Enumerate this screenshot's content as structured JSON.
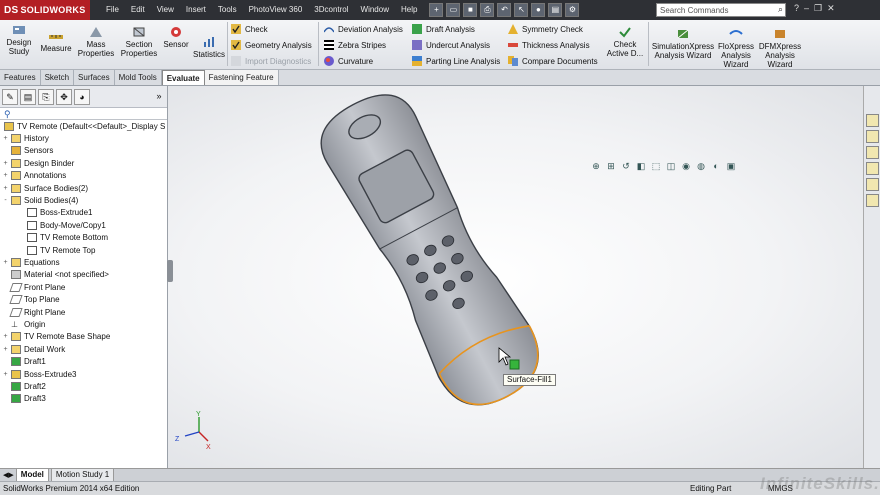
{
  "app": {
    "logo": "SOLIDWORKS",
    "logo_ds": "DS"
  },
  "menu": [
    "File",
    "Edit",
    "View",
    "Insert",
    "Tools",
    "PhotoView 360",
    "3Dcontrol",
    "Window",
    "Help"
  ],
  "search": {
    "placeholder": "Search Commands"
  },
  "ribbon": {
    "design_study": "Design\nStudy",
    "measure": "Measure",
    "mass_properties": "Mass\nProperties",
    "section_properties": "Section\nProperties",
    "sensor": "Sensor",
    "statistics": "Statistics",
    "check": "Check",
    "geometry_analysis": "Geometry Analysis",
    "import_diagnostics": "Import Diagnostics",
    "deviation_analysis": "Deviation Analysis",
    "zebra_stripes": "Zebra Stripes",
    "curvature": "Curvature",
    "draft_analysis": "Draft Analysis",
    "undercut_analysis": "Undercut Analysis",
    "parting_line_analysis": "Parting Line Analysis",
    "symmetry_check": "Symmetry Check",
    "thickness_analysis": "Thickness Analysis",
    "compare_documents": "Compare Documents",
    "check_active": "Check\nActive D...",
    "simulationxpress": "SimulationXpress\nAnalysis Wizard",
    "floxpress": "FloXpress\nAnalysis\nWizard",
    "dfmxpress": "DFMXpress\nAnalysis\nWizard"
  },
  "tabs": [
    "Features",
    "Sketch",
    "Surfaces",
    "Mold Tools",
    "Evaluate",
    "Fastening Feature"
  ],
  "active_tab": "Evaluate",
  "tree": {
    "root": "TV Remote  (Default<<Default>_Display S",
    "nodes": [
      {
        "label": "History",
        "pm": "+",
        "icon": "folder"
      },
      {
        "label": "Sensors",
        "pm": "",
        "icon": "sensor"
      },
      {
        "label": "Design Binder",
        "pm": "+",
        "icon": "folder"
      },
      {
        "label": "Annotations",
        "pm": "+",
        "icon": "folder"
      },
      {
        "label": "Surface Bodies(2)",
        "pm": "+",
        "icon": "folder"
      },
      {
        "label": "Solid Bodies(4)",
        "pm": "-",
        "icon": "folder"
      },
      {
        "label": "Boss-Extrude1",
        "pm": "",
        "icon": "body",
        "indent": 1
      },
      {
        "label": "Body-Move/Copy1",
        "pm": "",
        "icon": "body",
        "indent": 1
      },
      {
        "label": "TV Remote Bottom",
        "pm": "",
        "icon": "body",
        "indent": 1
      },
      {
        "label": "TV Remote Top",
        "pm": "",
        "icon": "body",
        "indent": 1
      },
      {
        "label": "Equations",
        "pm": "+",
        "icon": "equ"
      },
      {
        "label": "Material <not specified>",
        "pm": "",
        "icon": "mat"
      },
      {
        "label": "Front Plane",
        "pm": "",
        "icon": "plane"
      },
      {
        "label": "Top Plane",
        "pm": "",
        "icon": "plane"
      },
      {
        "label": "Right Plane",
        "pm": "",
        "icon": "plane"
      },
      {
        "label": "Origin",
        "pm": "",
        "icon": "origin"
      },
      {
        "label": "TV Remote Base Shape",
        "pm": "+",
        "icon": "folder"
      },
      {
        "label": "Detail Work",
        "pm": "+",
        "icon": "folder"
      },
      {
        "label": "Draft1",
        "pm": "",
        "icon": "draft"
      },
      {
        "label": "Boss-Extrude3",
        "pm": "+",
        "icon": "feat"
      },
      {
        "label": "Draft2",
        "pm": "",
        "icon": "draft"
      },
      {
        "label": "Draft3",
        "pm": "",
        "icon": "draft"
      }
    ]
  },
  "tooltip": "Surface-Fill1",
  "triad": {
    "x": "X",
    "y": "Y",
    "z": "Z"
  },
  "bottom_tabs": [
    "Model",
    "Motion Study 1"
  ],
  "status": {
    "left": "SolidWorks Premium 2014 x64 Edition",
    "mode": "Editing Part",
    "units": "MMGS"
  },
  "watermark": "InfiniteSkills.com"
}
